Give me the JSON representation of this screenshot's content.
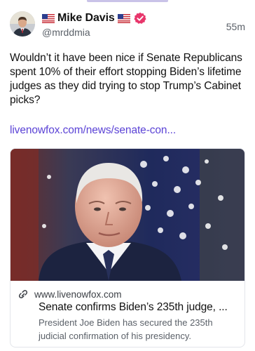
{
  "author": {
    "flag_left": "us-flag-icon",
    "name": "Mike Davis",
    "flag_right": "us-flag-icon",
    "verified_icon": "verified-badge-icon",
    "handle": "@mrddmia",
    "avatar_icon": "avatar"
  },
  "post": {
    "timestamp": "55m",
    "text": "Wouldn’t it have been nice if Senate Republicans spent 10% of their effort stopping Biden’s lifetime judges as they did trying to stop Trump’s Cabinet picks?",
    "link": "livenowfox.com/news/senate-con..."
  },
  "link_card": {
    "image_icon": "article-photo",
    "link_icon": "link-icon",
    "domain": "www.livenowfox.com",
    "title": "Senate confirms Biden’s 235th judge, ...",
    "description": "President Joe Biden has secured the 235th judicial confirmation of his presidency."
  },
  "colors": {
    "link": "#5b43d6",
    "muted": "#5b6169",
    "verified": "#e8366b",
    "border": "#e3e5ea"
  }
}
